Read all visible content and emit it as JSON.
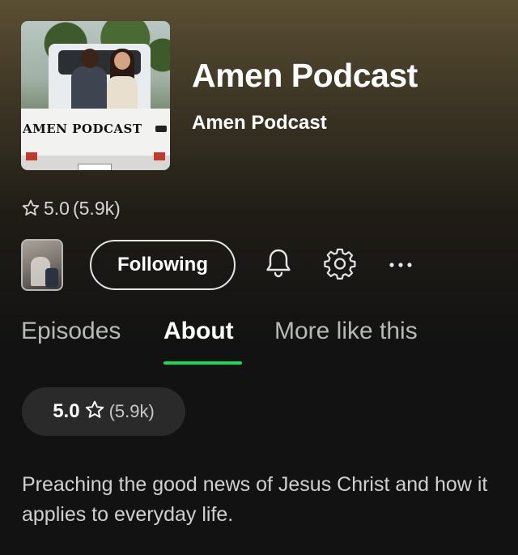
{
  "podcast": {
    "title": "Amen Podcast",
    "publisher": "Amen Podcast",
    "cover_text": "AMEN PODCAST",
    "rating": "5.0",
    "rating_count": "(5.9k)"
  },
  "actions": {
    "follow_label": "Following",
    "more_label": "···"
  },
  "tabs": [
    {
      "label": "Episodes",
      "active": false
    },
    {
      "label": "About",
      "active": true
    },
    {
      "label": "More like this",
      "active": false
    }
  ],
  "about": {
    "rating": "5.0",
    "rating_count": "(5.9k)",
    "description": "Preaching the good news of Jesus Christ and how it applies to everyday life."
  },
  "colors": {
    "background": "#121212",
    "hero_gradient_top": "#5a4e33",
    "accent": "#1ed760",
    "pill": "#2a2a2a"
  },
  "icons": [
    "star-outline-icon",
    "bell-icon",
    "gear-icon",
    "more-dots-icon"
  ]
}
